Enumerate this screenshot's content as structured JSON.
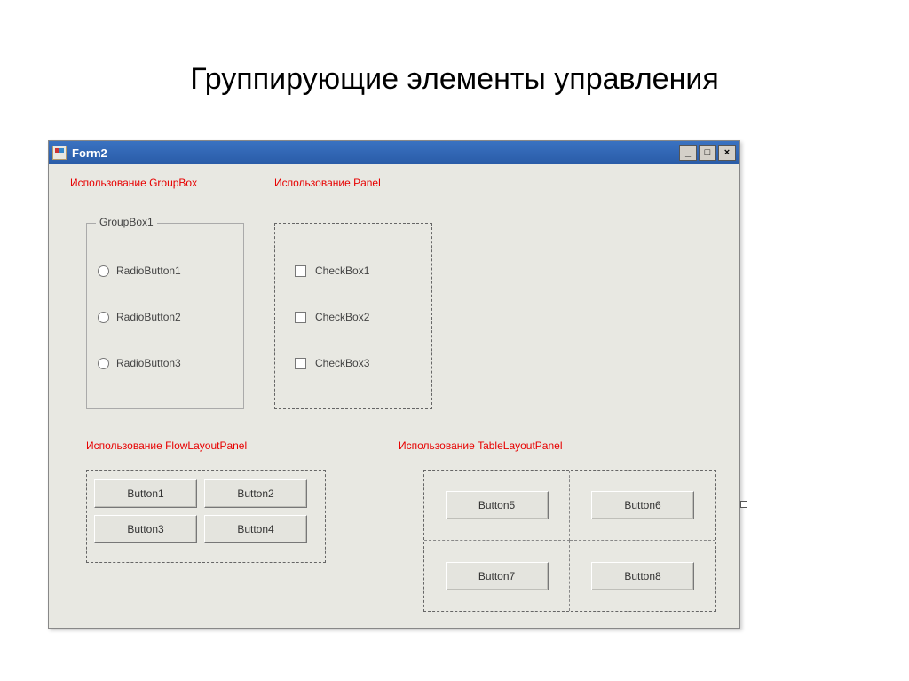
{
  "slide": {
    "title": "Группирующие элементы управления"
  },
  "window": {
    "title": "Form2"
  },
  "labels": {
    "groupbox_section": "Использование GroupBox",
    "panel_section": "Использование Panel",
    "flow_section": "Использование FlowLayoutPanel",
    "table_section": "Использование TableLayoutPanel"
  },
  "groupbox": {
    "legend": "GroupBox1",
    "radios": [
      "RadioButton1",
      "RadioButton2",
      "RadioButton3"
    ]
  },
  "panel": {
    "checks": [
      "CheckBox1",
      "CheckBox2",
      "CheckBox3"
    ]
  },
  "flow": {
    "buttons": [
      "Button1",
      "Button2",
      "Button3",
      "Button4"
    ]
  },
  "table": {
    "buttons": [
      "Button5",
      "Button6",
      "Button7",
      "Button8"
    ]
  },
  "winbtn": {
    "minimize": "_",
    "maximize": "□",
    "close": "×"
  }
}
